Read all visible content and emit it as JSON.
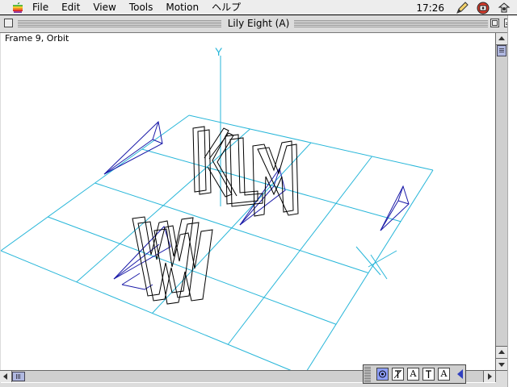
{
  "menubar": {
    "apple_icon": "apple-icon",
    "items": [
      "File",
      "Edit",
      "View",
      "Tools",
      "Motion",
      "ヘルプ"
    ],
    "clock": "17:26",
    "right_icons": [
      "pencil-icon",
      "app-icon",
      "finder-icon"
    ]
  },
  "window": {
    "title": "Lily Eight (A)"
  },
  "viewport": {
    "frame_label": "Frame 9, Orbit",
    "axis_label": "Y",
    "grid_color": "#27b6d9",
    "camera_color": "#1a1aa8",
    "letter_color": "#000000",
    "letters_back": [
      "K",
      "L",
      "M"
    ],
    "letters_front": [
      "W",
      "W"
    ]
  },
  "palette": {
    "tools": [
      "camera-tool-icon",
      "text-tool-icon",
      "A",
      "text-edit-icon",
      "A"
    ]
  },
  "colors": {
    "menubar_bg": "#ededed",
    "window_bg": "#dcdcdc",
    "scroll_thumb": "#b0b8e0",
    "palette_active": "#8fa0ff"
  }
}
